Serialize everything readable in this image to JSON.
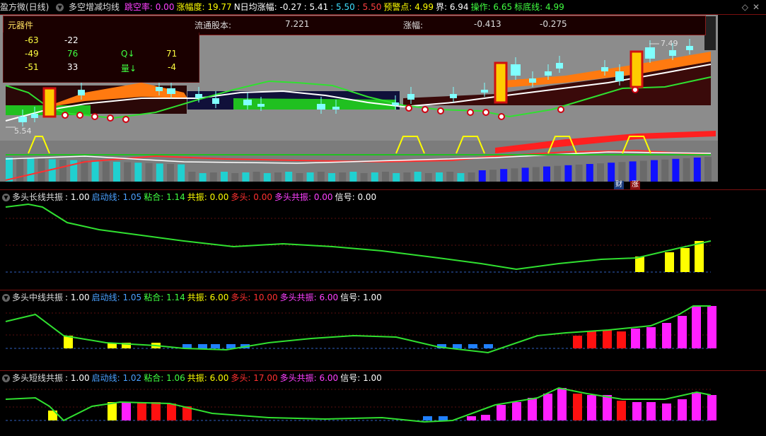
{
  "top": {
    "stock": "盈方微(日线)",
    "indicator": "多空增减均线",
    "items": [
      {
        "label": "跳空率:",
        "value": "0.00",
        "color": "#ff40ff"
      },
      {
        "label": "涨幅度:",
        "value": "19.77",
        "color": "#ffff00"
      },
      {
        "label": "N日均涨幅:",
        "value": "-0.27",
        "color": "#ffffff"
      },
      {
        "label": ":",
        "value": "5.41",
        "color": "#ffffff"
      },
      {
        "label": ":",
        "value": "5.50",
        "color": "#40e0ff"
      },
      {
        "label": ":",
        "value": "5.50",
        "color": "#ff4040"
      },
      {
        "label": "预警点:",
        "value": "4.99",
        "color": "#ffff00"
      },
      {
        "label": "界:",
        "value": "6.94",
        "color": "#ffffff"
      },
      {
        "label": "操作:",
        "value": "6.65",
        "color": "#40ff40"
      },
      {
        "label": "标底线:",
        "value": "4.99",
        "color": "#40ff40"
      }
    ]
  },
  "info": {
    "name": "元器件",
    "shares_label": "流通股本:",
    "shares_value": "7.221",
    "change_label": "涨幅:",
    "change_value": "-0.413",
    "change_value2": "-0.275"
  },
  "quad": {
    "r1": [
      "-63",
      "-22",
      "",
      ""
    ],
    "r2": [
      "-49",
      "76",
      "Q↓",
      "71"
    ],
    "r3": [
      "-51",
      "33",
      "量↓",
      "-4"
    ]
  },
  "price_labels": {
    "high": "7.49",
    "low": "5.54"
  },
  "tags": {
    "cai": "财",
    "zhang": "涨"
  },
  "panels": [
    {
      "title": "多头长线共振",
      "items": [
        {
          "label": ":",
          "value": "1.00",
          "color": "#ffffff"
        },
        {
          "label": "启动线:",
          "value": "1.05",
          "color": "#4aa0ff"
        },
        {
          "label": "粘合:",
          "value": "1.14",
          "color": "#40ff40"
        },
        {
          "label": "共振:",
          "value": "0.00",
          "color": "#ffff00"
        },
        {
          "label": "多头:",
          "value": "0.00",
          "color": "#ff3030"
        },
        {
          "label": "多头共振:",
          "value": "0.00",
          "color": "#ff40ff"
        },
        {
          "label": "信号:",
          "value": "0.00",
          "color": "#ffffff"
        }
      ]
    },
    {
      "title": "多头中线共振",
      "items": [
        {
          "label": ":",
          "value": "1.00",
          "color": "#ffffff"
        },
        {
          "label": "启动线:",
          "value": "1.05",
          "color": "#4aa0ff"
        },
        {
          "label": "粘合:",
          "value": "1.14",
          "color": "#40ff40"
        },
        {
          "label": "共振:",
          "value": "6.00",
          "color": "#ffff00"
        },
        {
          "label": "多头:",
          "value": "10.00",
          "color": "#ff3030"
        },
        {
          "label": "多头共振:",
          "value": "6.00",
          "color": "#ff40ff"
        },
        {
          "label": "信号:",
          "value": "1.00",
          "color": "#ffffff"
        }
      ]
    },
    {
      "title": "多头短线共振",
      "items": [
        {
          "label": ":",
          "value": "1.00",
          "color": "#ffffff"
        },
        {
          "label": "启动线:",
          "value": "1.02",
          "color": "#4aa0ff"
        },
        {
          "label": "粘合:",
          "value": "1.06",
          "color": "#40ff40"
        },
        {
          "label": "共振:",
          "value": "6.00",
          "color": "#ffff00"
        },
        {
          "label": "多头:",
          "value": "17.00",
          "color": "#ff3030"
        },
        {
          "label": "多头共振:",
          "value": "6.00",
          "color": "#ff40ff"
        },
        {
          "label": "信号:",
          "value": "1.00",
          "color": "#ffffff"
        }
      ]
    }
  ],
  "colors": {
    "accent_red": "#b01010",
    "bull_magenta": "#ff20ff",
    "bull_red": "#ff1010",
    "signal_yellow": "#ffff00",
    "line_green": "#30e030",
    "bear_blue": "#2080ff"
  }
}
